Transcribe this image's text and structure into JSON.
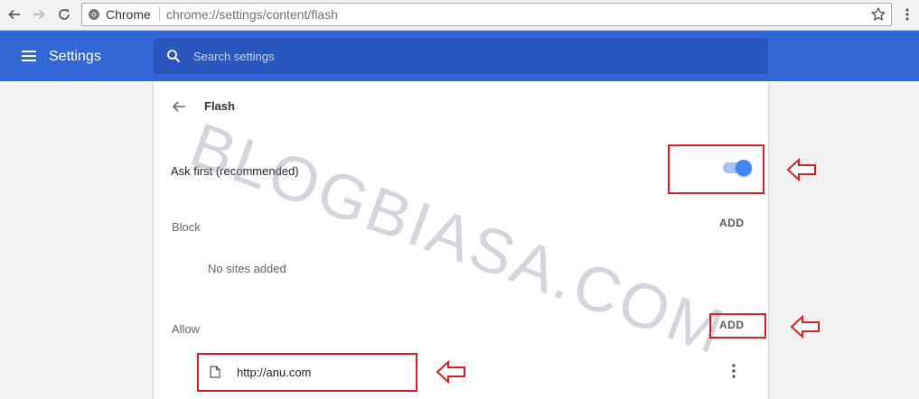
{
  "browser": {
    "site_name": "Chrome",
    "url": "chrome://settings/content/flash",
    "icons": {
      "back": "back-arrow-icon",
      "forward": "forward-arrow-icon",
      "reload": "reload-icon",
      "site": "chrome-page-icon",
      "bookmark": "star-icon",
      "menu": "kebab-menu-icon"
    }
  },
  "header": {
    "title": "Settings",
    "search_placeholder": "Search settings",
    "bg_color": "#3367d6"
  },
  "page": {
    "title": "Flash",
    "ask_first": {
      "label": "Ask first (recommended)",
      "enabled": true,
      "accent_color": "#4285f4"
    },
    "block": {
      "label": "Block",
      "add_label": "ADD",
      "empty_text": "No sites added"
    },
    "allow": {
      "label": "Allow",
      "add_label": "ADD",
      "sites": [
        {
          "url": "http://anu.com"
        }
      ]
    }
  },
  "watermark": "BLOGBIASA.COM",
  "annotation_color": "#d32027"
}
